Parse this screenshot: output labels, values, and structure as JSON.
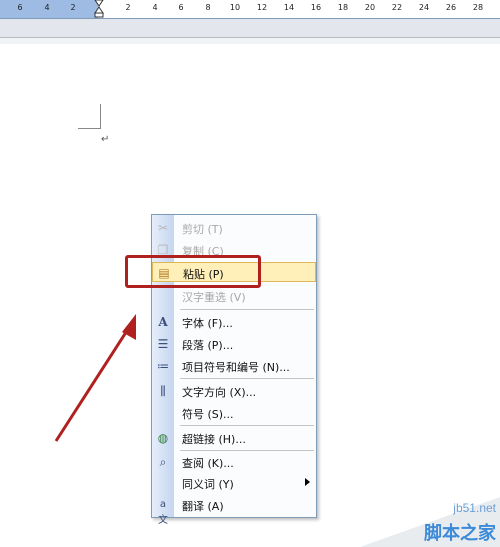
{
  "ruler": {
    "left_numbers": [
      "6",
      "4",
      "2"
    ],
    "right_numbers": [
      "2",
      "4",
      "6",
      "8",
      "10",
      "12",
      "14",
      "16",
      "18",
      "20",
      "22",
      "24",
      "26",
      "28"
    ]
  },
  "document": {
    "paragraph_mark": "↵"
  },
  "context_menu": {
    "items": [
      {
        "label": "剪切 (T)",
        "icon": "scissors-icon",
        "disabled": true
      },
      {
        "label": "复制 (C)",
        "icon": "copy-icon",
        "disabled": true
      },
      {
        "label": "粘贴 (P)",
        "icon": "paste-icon",
        "disabled": false,
        "highlighted": true
      },
      {
        "label": "汉字重选 (V)",
        "icon": "",
        "disabled": true
      },
      {
        "label": "字体 (F)...",
        "icon": "font-icon",
        "disabled": false
      },
      {
        "label": "段落 (P)...",
        "icon": "paragraph-icon",
        "disabled": false
      },
      {
        "label": "项目符号和编号 (N)...",
        "icon": "bullets-icon",
        "disabled": false
      },
      {
        "label": "文字方向 (X)...",
        "icon": "text-direction-icon",
        "disabled": false
      },
      {
        "label": "符号 (S)...",
        "icon": "",
        "disabled": false
      },
      {
        "label": "超链接 (H)...",
        "icon": "hyperlink-icon",
        "disabled": false
      },
      {
        "label": "查阅 (K)...",
        "icon": "research-icon",
        "disabled": false
      },
      {
        "label": "同义词 (Y)",
        "icon": "",
        "disabled": false,
        "submenu": true
      },
      {
        "label": "翻译 (A)",
        "icon": "translate-icon",
        "disabled": false
      }
    ]
  },
  "annotation": {
    "highlight_color": "#b0201f",
    "arrow_color": "#b0201f"
  },
  "watermark": {
    "url": "jb51.net",
    "name": "脚本之家"
  }
}
